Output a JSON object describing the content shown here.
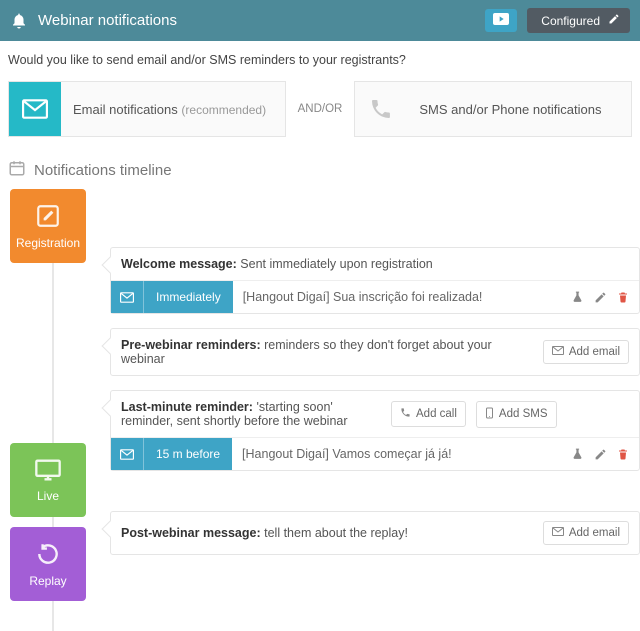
{
  "header": {
    "title": "Webinar notifications",
    "configured_label": "Configured"
  },
  "intro": "Would you like to send email and/or SMS reminders to your registrants?",
  "channels": {
    "email_label": "Email notifications",
    "email_rec": "(recommended)",
    "andor": "AND/OR",
    "sms_label": "SMS and/or Phone notifications"
  },
  "timeline_title": "Notifications timeline",
  "stages": {
    "registration": "Registration",
    "live": "Live",
    "replay": "Replay"
  },
  "cards": {
    "welcome": {
      "title": "Welcome message:",
      "desc": "Sent immediately upon registration",
      "row": {
        "timing": "Immediately",
        "subject": "[Hangout Digaí] Sua inscrição foi realizada!"
      }
    },
    "pre": {
      "title": "Pre-webinar reminders:",
      "desc": "reminders so they don't forget about your webinar",
      "add_email": "Add email"
    },
    "last": {
      "title": "Last-minute reminder:",
      "desc": "'starting soon' reminder, sent shortly before the webinar",
      "add_call": "Add call",
      "add_sms": "Add SMS",
      "row": {
        "timing": "15 m before",
        "subject": "[Hangout Digaí] Vamos começar já já!"
      }
    },
    "post": {
      "title": "Post-webinar message:",
      "desc": "tell them about the replay!",
      "add_email": "Add email"
    }
  }
}
